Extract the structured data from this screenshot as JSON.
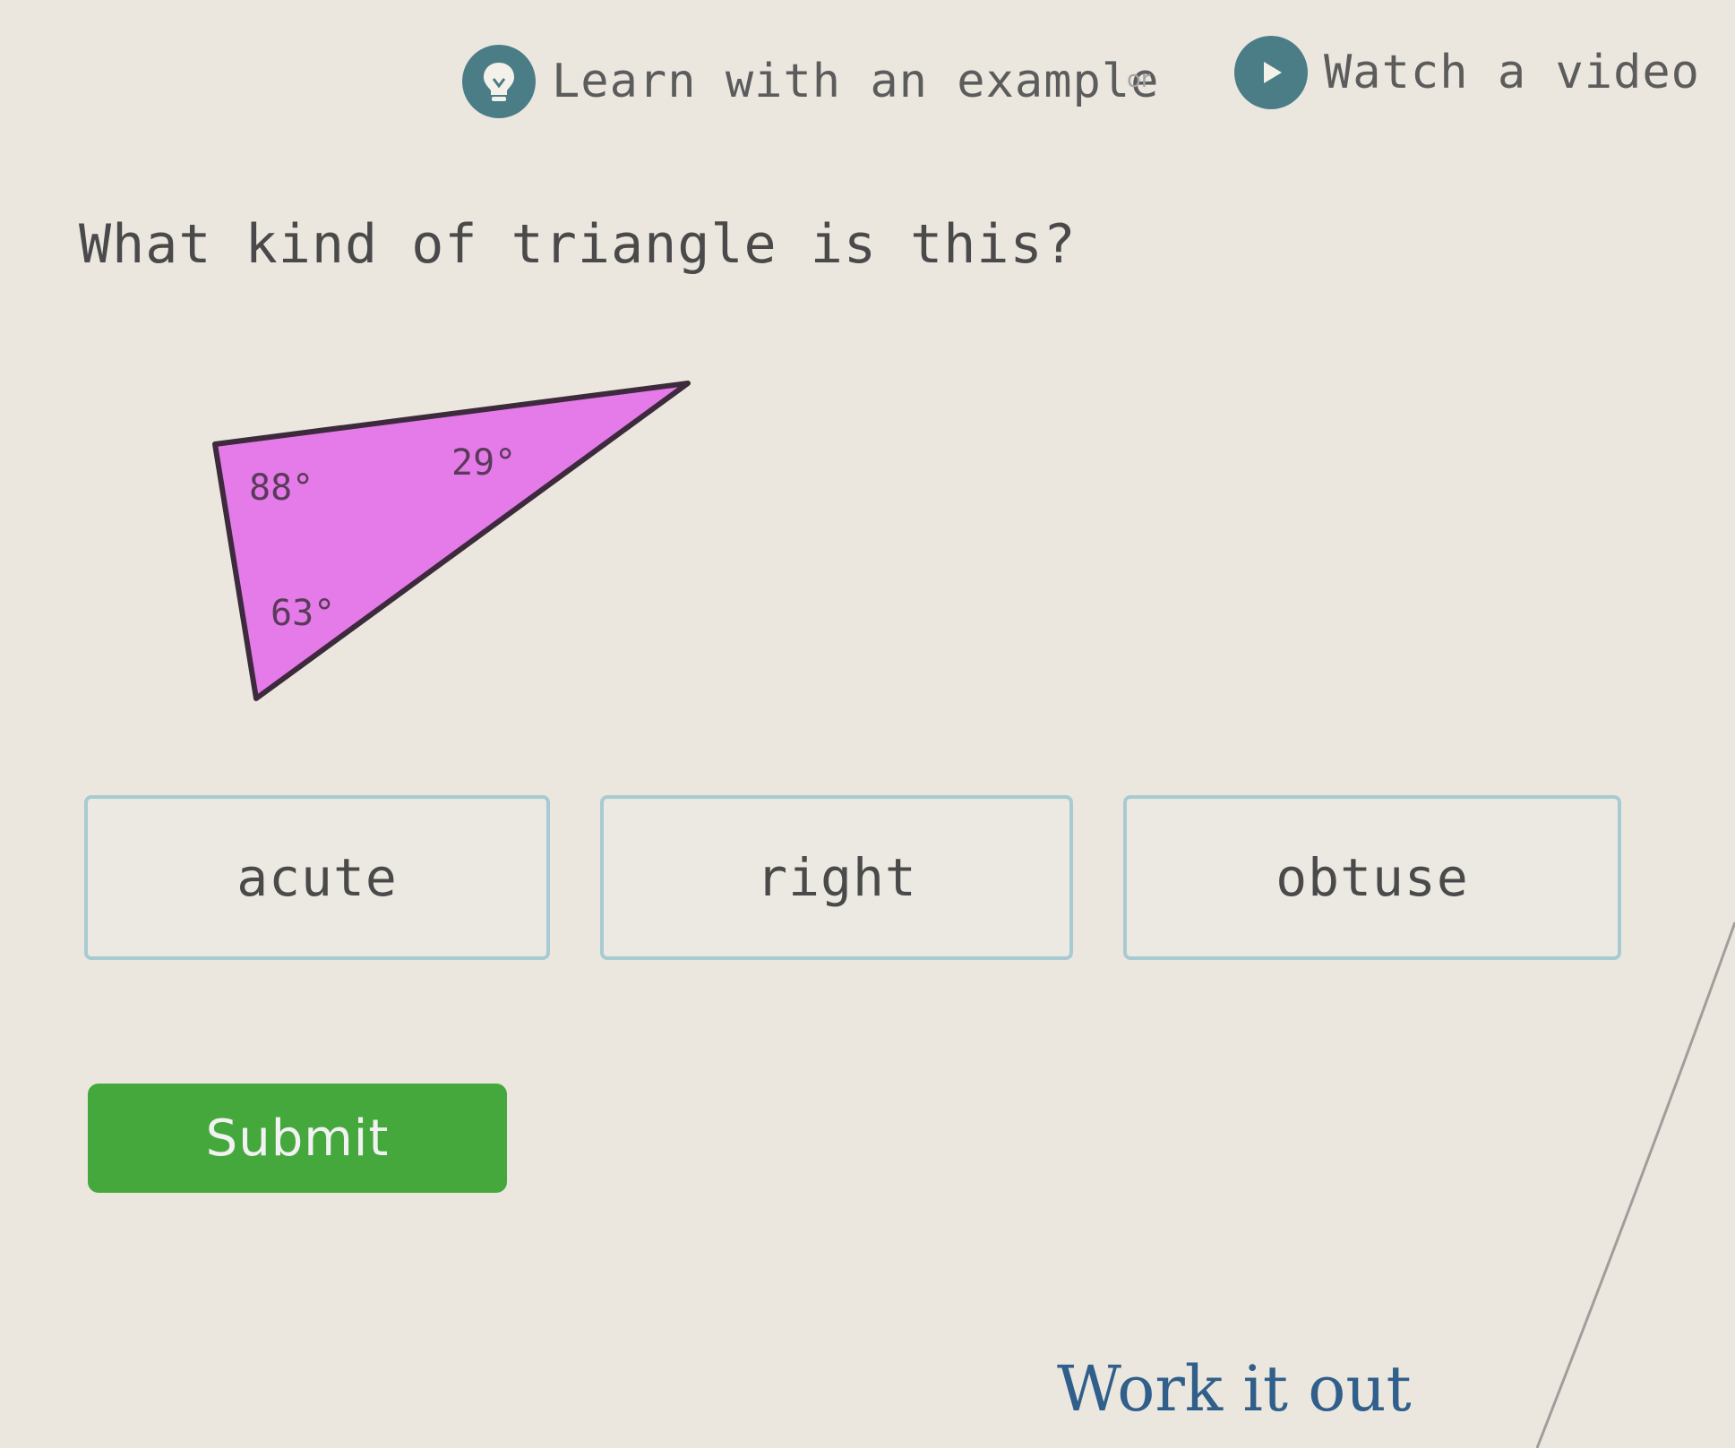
{
  "help": {
    "example_label": "Learn with an example",
    "or_text": "or",
    "video_label": "Watch a video"
  },
  "question": {
    "text": "What kind of triangle is this?"
  },
  "figure": {
    "fill_color": "#e57be8",
    "angles": [
      "88°",
      "29°",
      "63°"
    ]
  },
  "answers": [
    {
      "label": "acute"
    },
    {
      "label": "right"
    },
    {
      "label": "obtuse"
    }
  ],
  "submit": {
    "label": "Submit",
    "color": "#45a83c"
  },
  "work_it_out": {
    "label": "Work it out"
  }
}
